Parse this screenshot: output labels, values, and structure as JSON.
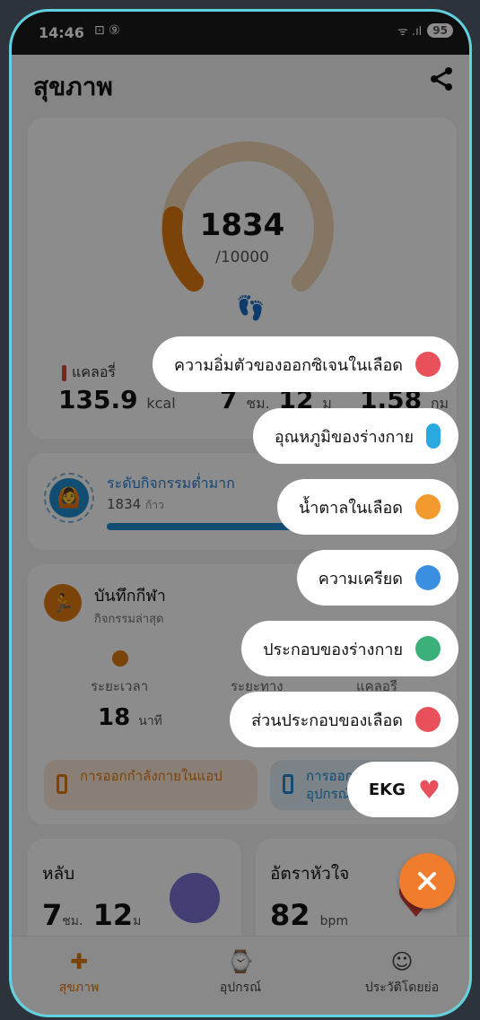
{
  "status": {
    "time": "14:46",
    "icons": "⊡ ⑨",
    "network": "ᯤ .ıl",
    "battery": "95"
  },
  "header": {
    "title": "สุขภาพ"
  },
  "steps": {
    "count": "1834",
    "goal": "/10000",
    "progress": 0.183
  },
  "stats": {
    "cal_label": "แคลอรี่",
    "cal_value": "135.9",
    "cal_unit": "kcal",
    "time_value": "7",
    "time_unit1": "ชม.",
    "time_value2": "12",
    "time_unit2": "ม",
    "dist_value": "1.58",
    "dist_unit": "กม"
  },
  "activity": {
    "title": "ระดับกิจกรรมต่ำมาก",
    "steps": "1834",
    "steps_unit": "ก้าว",
    "progress": 0.65
  },
  "sport": {
    "title": "บันทึกกีฬา",
    "subtitle": "กิจกรรมล่าสุด",
    "labels": [
      "ระยะเวลา",
      "ระยะทาง",
      "แคลอรี"
    ],
    "duration": "18",
    "duration_unit": "นาที",
    "btn_app": "การออกกำลังกายในแอป",
    "btn_device": "การออกกำลังกายในอุปกรณ์"
  },
  "sleep": {
    "title": "หลับ",
    "h": "7",
    "h_unit": "ชม.",
    "m": "12",
    "m_unit": "ม"
  },
  "heart": {
    "title": "อัตราหัวใจ",
    "value": "82",
    "unit": "bpm"
  },
  "nav": {
    "items": [
      {
        "label": "สุขภาพ",
        "active": true
      },
      {
        "label": "อุปกรณ์"
      },
      {
        "label": "ประวัติโดยย่อ"
      }
    ]
  },
  "menu": [
    {
      "label": "ความอิ่มตัวของออกซิเจนในเลือด",
      "icon": "blood-oxygen-icon",
      "color": "#e8505b"
    },
    {
      "label": "อุณหภูมิของร่างกาย",
      "icon": "thermometer-icon",
      "color": "#2aa8e0"
    },
    {
      "label": "น้ำตาลในเลือด",
      "icon": "blood-sugar-icon",
      "color": "#f29a2e"
    },
    {
      "label": "ความเครียด",
      "icon": "stress-icon",
      "color": "#3a8fe0"
    },
    {
      "label": "ประกอบของร่างกาย",
      "icon": "body-composition-icon",
      "color": "#3bb07a"
    },
    {
      "label": "ส่วนประกอบของเลือด",
      "icon": "blood-composition-icon",
      "color": "#e8505b"
    },
    {
      "label": "EKG",
      "icon": "ekg-heart-icon",
      "color": "#e8505b"
    }
  ],
  "colors": {
    "accent": "#e07a10",
    "blue": "#1f8bd1",
    "fab": "#ef7d2d"
  }
}
